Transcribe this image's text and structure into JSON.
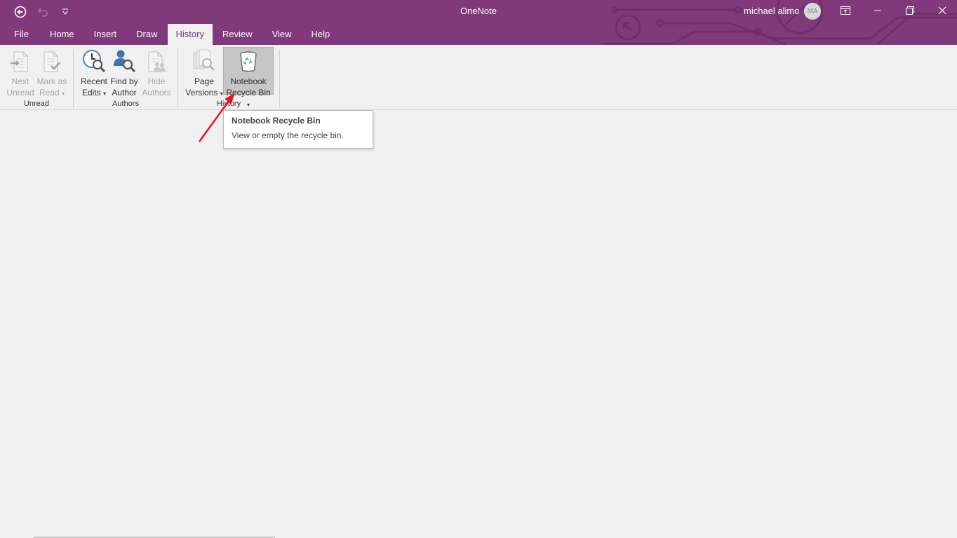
{
  "window": {
    "title": "OneNote",
    "user_name": "michael alimo",
    "avatar_initials": "MA",
    "accent_color": "#80397b"
  },
  "quick_access": {
    "back_icon": "back-arrow-icon",
    "undo_icon": "undo-icon",
    "customize_icon": "customize-qat-icon"
  },
  "window_controls": {
    "ribbon_display": "ribbon-display-options-icon",
    "minimize": "minimize-icon",
    "restore": "restore-icon",
    "close": "close-icon"
  },
  "tabs": [
    {
      "label": "File",
      "active": false
    },
    {
      "label": "Home",
      "active": false
    },
    {
      "label": "Insert",
      "active": false
    },
    {
      "label": "Draw",
      "active": false
    },
    {
      "label": "History",
      "active": true
    },
    {
      "label": "Review",
      "active": false
    },
    {
      "label": "View",
      "active": false
    },
    {
      "label": "Help",
      "active": false
    }
  ],
  "ribbon": {
    "groups": [
      {
        "label": "Unread",
        "buttons": [
          {
            "line1": "Next",
            "line2": "Unread",
            "enabled": false,
            "icon": "next-unread-icon"
          },
          {
            "line1": "Mark as",
            "line2": "Read",
            "enabled": false,
            "dropdown": true,
            "icon": "mark-as-read-icon"
          }
        ]
      },
      {
        "label": "Authors",
        "buttons": [
          {
            "line1": "Recent",
            "line2": "Edits",
            "enabled": true,
            "dropdown": true,
            "icon": "recent-edits-icon"
          },
          {
            "line1": "Find by",
            "line2": "Author",
            "enabled": true,
            "icon": "find-by-author-icon"
          },
          {
            "line1": "Hide",
            "line2": "Authors",
            "enabled": false,
            "icon": "hide-authors-icon"
          }
        ]
      },
      {
        "label": "History",
        "buttons": [
          {
            "line1": "Page",
            "line2": "Versions",
            "enabled": true,
            "dropdown": true,
            "icon": "page-versions-icon"
          },
          {
            "line1": "Notebook",
            "line2": "Recycle Bin",
            "enabled": true,
            "dropdown": true,
            "highlighted": true,
            "icon": "recycle-bin-icon"
          }
        ]
      }
    ],
    "dropdown_glyph": "▾"
  },
  "tooltip": {
    "title": "Notebook Recycle Bin",
    "description": "View or empty the recycle bin."
  }
}
